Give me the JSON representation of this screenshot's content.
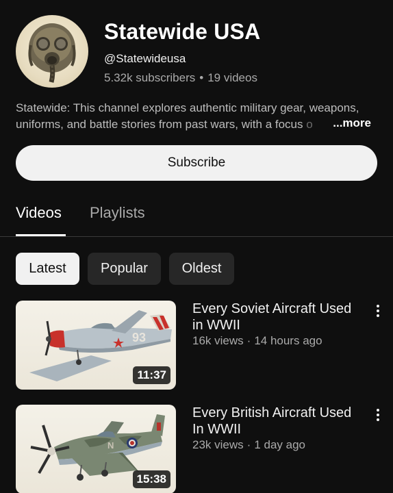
{
  "channel": {
    "name": "Statewide USA",
    "handle": "@Statewideusa",
    "subscribers": "5.32k subscribers",
    "separator": "•",
    "videos_count": "19 videos",
    "description_line1": "Statewide: This channel explores authentic military gear, weapons,",
    "description_line2": "uniforms, and battle stories from past wars, with a focus",
    "description_fade": "o",
    "more_label": "...more",
    "avatar_icon": "gas-mask-icon"
  },
  "subscribe": {
    "label": "Subscribe",
    "color": "#f1f1f1"
  },
  "tabs": [
    {
      "label": "Videos",
      "active": true
    },
    {
      "label": "Playlists",
      "active": false
    }
  ],
  "chips": [
    {
      "label": "Latest",
      "active": true
    },
    {
      "label": "Popular",
      "active": false
    },
    {
      "label": "Oldest",
      "active": false
    }
  ],
  "videos": [
    {
      "title": "Every Soviet Aircraft Used in WWII",
      "views": "16k views",
      "sep": "·",
      "age": "14 hours ago",
      "duration": "11:37",
      "thumb_icon": "soviet-fighter-plane-icon"
    },
    {
      "title": "Every British Aircraft Used In WWII",
      "views": "23k views",
      "sep": "·",
      "age": "1 day ago",
      "duration": "15:38",
      "thumb_icon": "spitfire-plane-icon"
    }
  ],
  "colors": {
    "background": "#0f0f0f",
    "text_primary": "#f1f1f1",
    "text_secondary": "#aaaaaa",
    "chip_bg": "#272727"
  }
}
